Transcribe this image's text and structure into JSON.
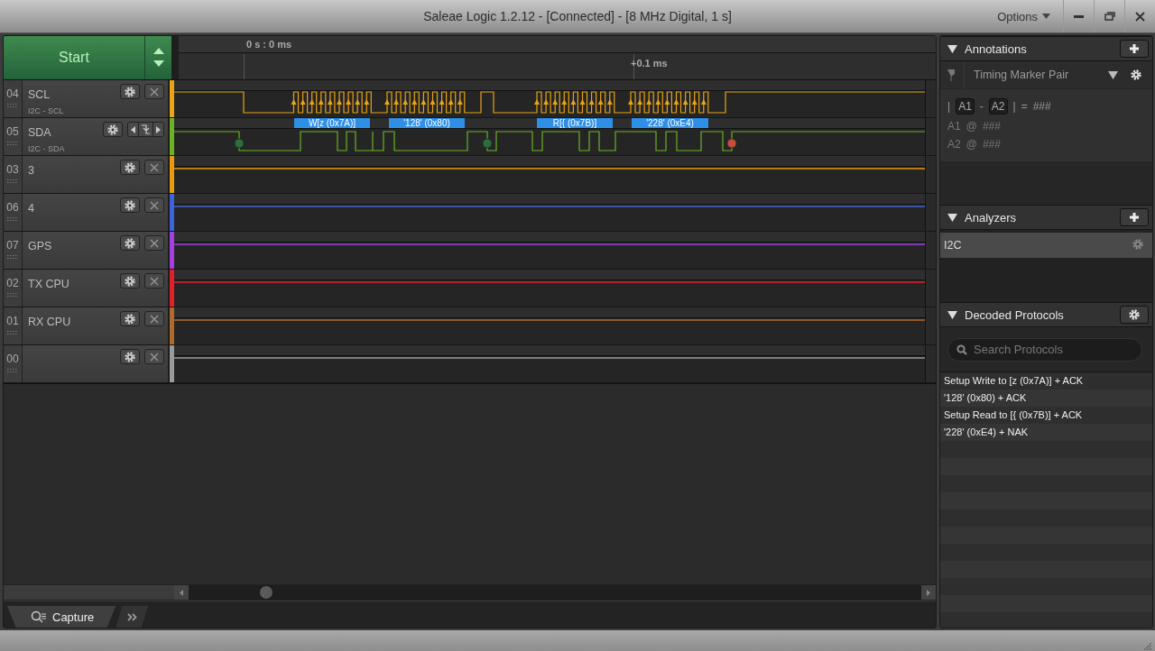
{
  "window": {
    "title": "Saleae Logic 1.2.12 - [Connected] - [8 MHz Digital, 1 s]",
    "menu": "Options"
  },
  "start_button": {
    "label": "Start"
  },
  "timeline": {
    "ticks": [
      {
        "label": "0 s : 0 ms"
      },
      {
        "label": "+0.1 ms"
      }
    ]
  },
  "channels": [
    {
      "index": "04",
      "name": "SCL",
      "subtitle": "I2C - SCL",
      "color": "#e8a317",
      "kind": "clock"
    },
    {
      "index": "05",
      "name": "SDA",
      "subtitle": "I2C - SDA",
      "color": "#6bb324",
      "kind": "data",
      "decodes": [
        "W[z (0x7A)]",
        "'128' (0x80)",
        "R[{ (0x7B)]",
        "'228' (0xE4)"
      ]
    },
    {
      "index": "03",
      "name": "3",
      "color": "#e89a10",
      "kind": "idle"
    },
    {
      "index": "06",
      "name": "4",
      "color": "#3f64d8",
      "kind": "idle"
    },
    {
      "index": "07",
      "name": "GPS",
      "color": "#a43fe0",
      "kind": "idle"
    },
    {
      "index": "02",
      "name": "TX CPU",
      "color": "#e0202a",
      "kind": "idle"
    },
    {
      "index": "01",
      "name": "RX CPU",
      "color": "#b06a2c",
      "kind": "idle"
    },
    {
      "index": "00",
      "color": "#9a9a9a",
      "kind": "idle"
    }
  ],
  "bottom_tabs": [
    {
      "label": "Capture",
      "selected": true
    }
  ],
  "annotations": {
    "title": "Annotations",
    "expanded": true,
    "marker_type": "Timing Marker Pair",
    "delta": {
      "open": "|",
      "a": "A1",
      "dash": "-",
      "b": "A2",
      "close": "|",
      "equals": "=",
      "value": "###"
    },
    "markers": [
      {
        "label": "A1",
        "at": "@",
        "value": "###"
      },
      {
        "label": "A2",
        "at": "@",
        "value": "###"
      }
    ]
  },
  "analyzers": {
    "title": "Analyzers",
    "expanded": true,
    "items": [
      {
        "name": "I2C",
        "selected": true
      }
    ]
  },
  "decoded_protocols": {
    "title": "Decoded Protocols",
    "expanded": true,
    "search_placeholder": "Search Protocols",
    "rows": [
      "Setup Write to [z (0x7A)] + ACK",
      "'128' (0x80) + ACK",
      "Setup Read to [{ (0x7B)] + ACK",
      "'228' (0xE4) + NAK"
    ]
  }
}
